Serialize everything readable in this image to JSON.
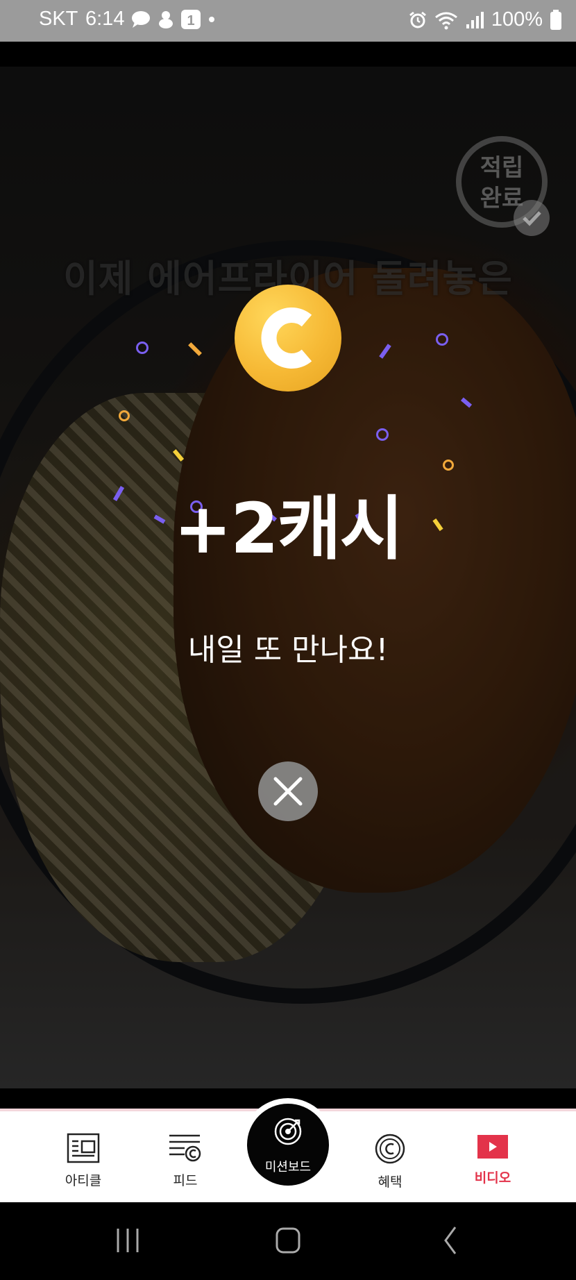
{
  "status_bar": {
    "carrier": "SKT",
    "time": "6:14",
    "battery": "100%"
  },
  "video": {
    "subtitle": "이제 에어프라이어 돌려놓은",
    "stamp_text_line1": "적립",
    "stamp_text_line2": "완료"
  },
  "reward_popup": {
    "amount": "+2캐시",
    "message": "내일 또 만나요!",
    "coin_color": "#F6B935"
  },
  "bottom_nav": {
    "items": [
      {
        "label": "아티클",
        "icon": "article-icon"
      },
      {
        "label": "피드",
        "icon": "feed-icon"
      },
      {
        "label": "미션보드",
        "icon": "target-icon"
      },
      {
        "label": "혜택",
        "icon": "cash-coin-icon"
      },
      {
        "label": "비디오",
        "icon": "video-play-icon"
      }
    ],
    "active_color": "#E3334A"
  }
}
